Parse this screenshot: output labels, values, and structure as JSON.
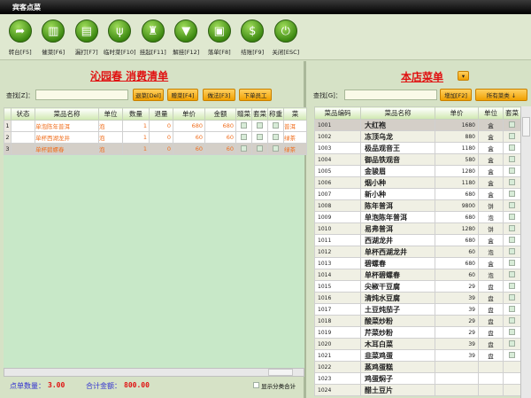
{
  "window": {
    "title": "宾客点菜"
  },
  "toolbar": [
    {
      "label": "转台[F5]",
      "icon": "arrow-icon",
      "glyph": "➦"
    },
    {
      "label": "催菜[F6]",
      "icon": "bank-icon",
      "glyph": "▥"
    },
    {
      "label": "漏打[F7]",
      "icon": "document-icon",
      "glyph": "▤"
    },
    {
      "label": "临时菜[F10]",
      "icon": "utensils-icon",
      "glyph": "ψ"
    },
    {
      "label": "挂起[F11]",
      "icon": "waiter-icon",
      "glyph": "♜"
    },
    {
      "label": "解挂[F12]",
      "icon": "tie-icon",
      "glyph": "▼"
    },
    {
      "label": "落单[F8]",
      "icon": "receipt-icon",
      "glyph": "▣"
    },
    {
      "label": "结账[F9]",
      "icon": "dollar-icon",
      "glyph": "$"
    },
    {
      "label": "关闭[ESC]",
      "icon": "power-icon",
      "glyph": "⏻"
    }
  ],
  "left": {
    "title": "沁园春  消费清单",
    "search_label": "查找[Z]：",
    "search_value": "",
    "buttons": [
      "退菜[Del]",
      "赠菜[F4]",
      "做法[F3]",
      "下单员工"
    ],
    "columns": [
      "",
      "状态",
      "菜品名称",
      "单位",
      "数量",
      "退量",
      "单价",
      "金额",
      "赠菜",
      "套菜",
      "称重",
      "菜"
    ],
    "rows": [
      {
        "n": "1",
        "status": "",
        "name": "单泡陈年普洱",
        "unit": "泡",
        "qty": "1",
        "ret": "0",
        "price": "680",
        "amount": "680",
        "extra": "普洱"
      },
      {
        "n": "2",
        "status": "",
        "name": "单杯西湖龙井",
        "unit": "泡",
        "qty": "1",
        "ret": "0",
        "price": "60",
        "amount": "60",
        "extra": "绿茶"
      },
      {
        "n": "3",
        "status": "",
        "name": "单杯碧螺春",
        "unit": "泡",
        "qty": "1",
        "ret": "0",
        "price": "60",
        "amount": "60",
        "extra": "绿茶"
      }
    ],
    "footer": {
      "count_label": "点单数量：",
      "count": "3.00",
      "total_label": "合计金额：",
      "total": "800.00",
      "show_category": "显示分类合计"
    }
  },
  "right": {
    "title": "本店菜单",
    "search_label": "查找[G]：",
    "search_value": "",
    "add_button": "增加[F2]",
    "category_button": "所有菜类 ↓",
    "columns": [
      "菜品编码",
      "菜品名称",
      "单价",
      "单位",
      "套菜"
    ],
    "rows": [
      [
        "1001",
        "大红袍",
        "1680",
        "盒"
      ],
      [
        "1002",
        "冻顶乌龙",
        "880",
        "盒"
      ],
      [
        "1003",
        "极品观音王",
        "1180",
        "盒"
      ],
      [
        "1004",
        "御品铁观音",
        "580",
        "盒"
      ],
      [
        "1005",
        "金骏眉",
        "1280",
        "盒"
      ],
      [
        "1006",
        "烟小种",
        "1180",
        "盒"
      ],
      [
        "1007",
        "新小种",
        "680",
        "盒"
      ],
      [
        "1008",
        "陈年普洱",
        "9800",
        "饼"
      ],
      [
        "1009",
        "单泡陈年普洱",
        "680",
        "泡"
      ],
      [
        "1010",
        "易弗普洱",
        "1280",
        "饼"
      ],
      [
        "1011",
        "西湖龙井",
        "680",
        "盒"
      ],
      [
        "1012",
        "单杯西湖龙井",
        "60",
        "泡"
      ],
      [
        "1013",
        "碧螺春",
        "680",
        "盒"
      ],
      [
        "1014",
        "单杯碧螺春",
        "60",
        "泡"
      ],
      [
        "1015",
        "尖椒干豆腐",
        "29",
        "盘"
      ],
      [
        "1016",
        "清炖水豆腐",
        "39",
        "盘"
      ],
      [
        "1017",
        "土豆炖茄子",
        "39",
        "盘"
      ],
      [
        "1018",
        "酸菜炒粉",
        "29",
        "盘"
      ],
      [
        "1019",
        "芹菜炒粉",
        "29",
        "盘"
      ],
      [
        "1020",
        "木耳白菜",
        "39",
        "盘"
      ],
      [
        "1021",
        "韭菜鸡蛋",
        "39",
        "盘"
      ],
      [
        "1022",
        "蒸鸡蛋糕",
        "",
        ""
      ],
      [
        "1023",
        "鸡蛋焖子",
        "",
        ""
      ],
      [
        "1024",
        "醋土豆片",
        "",
        ""
      ]
    ]
  }
}
